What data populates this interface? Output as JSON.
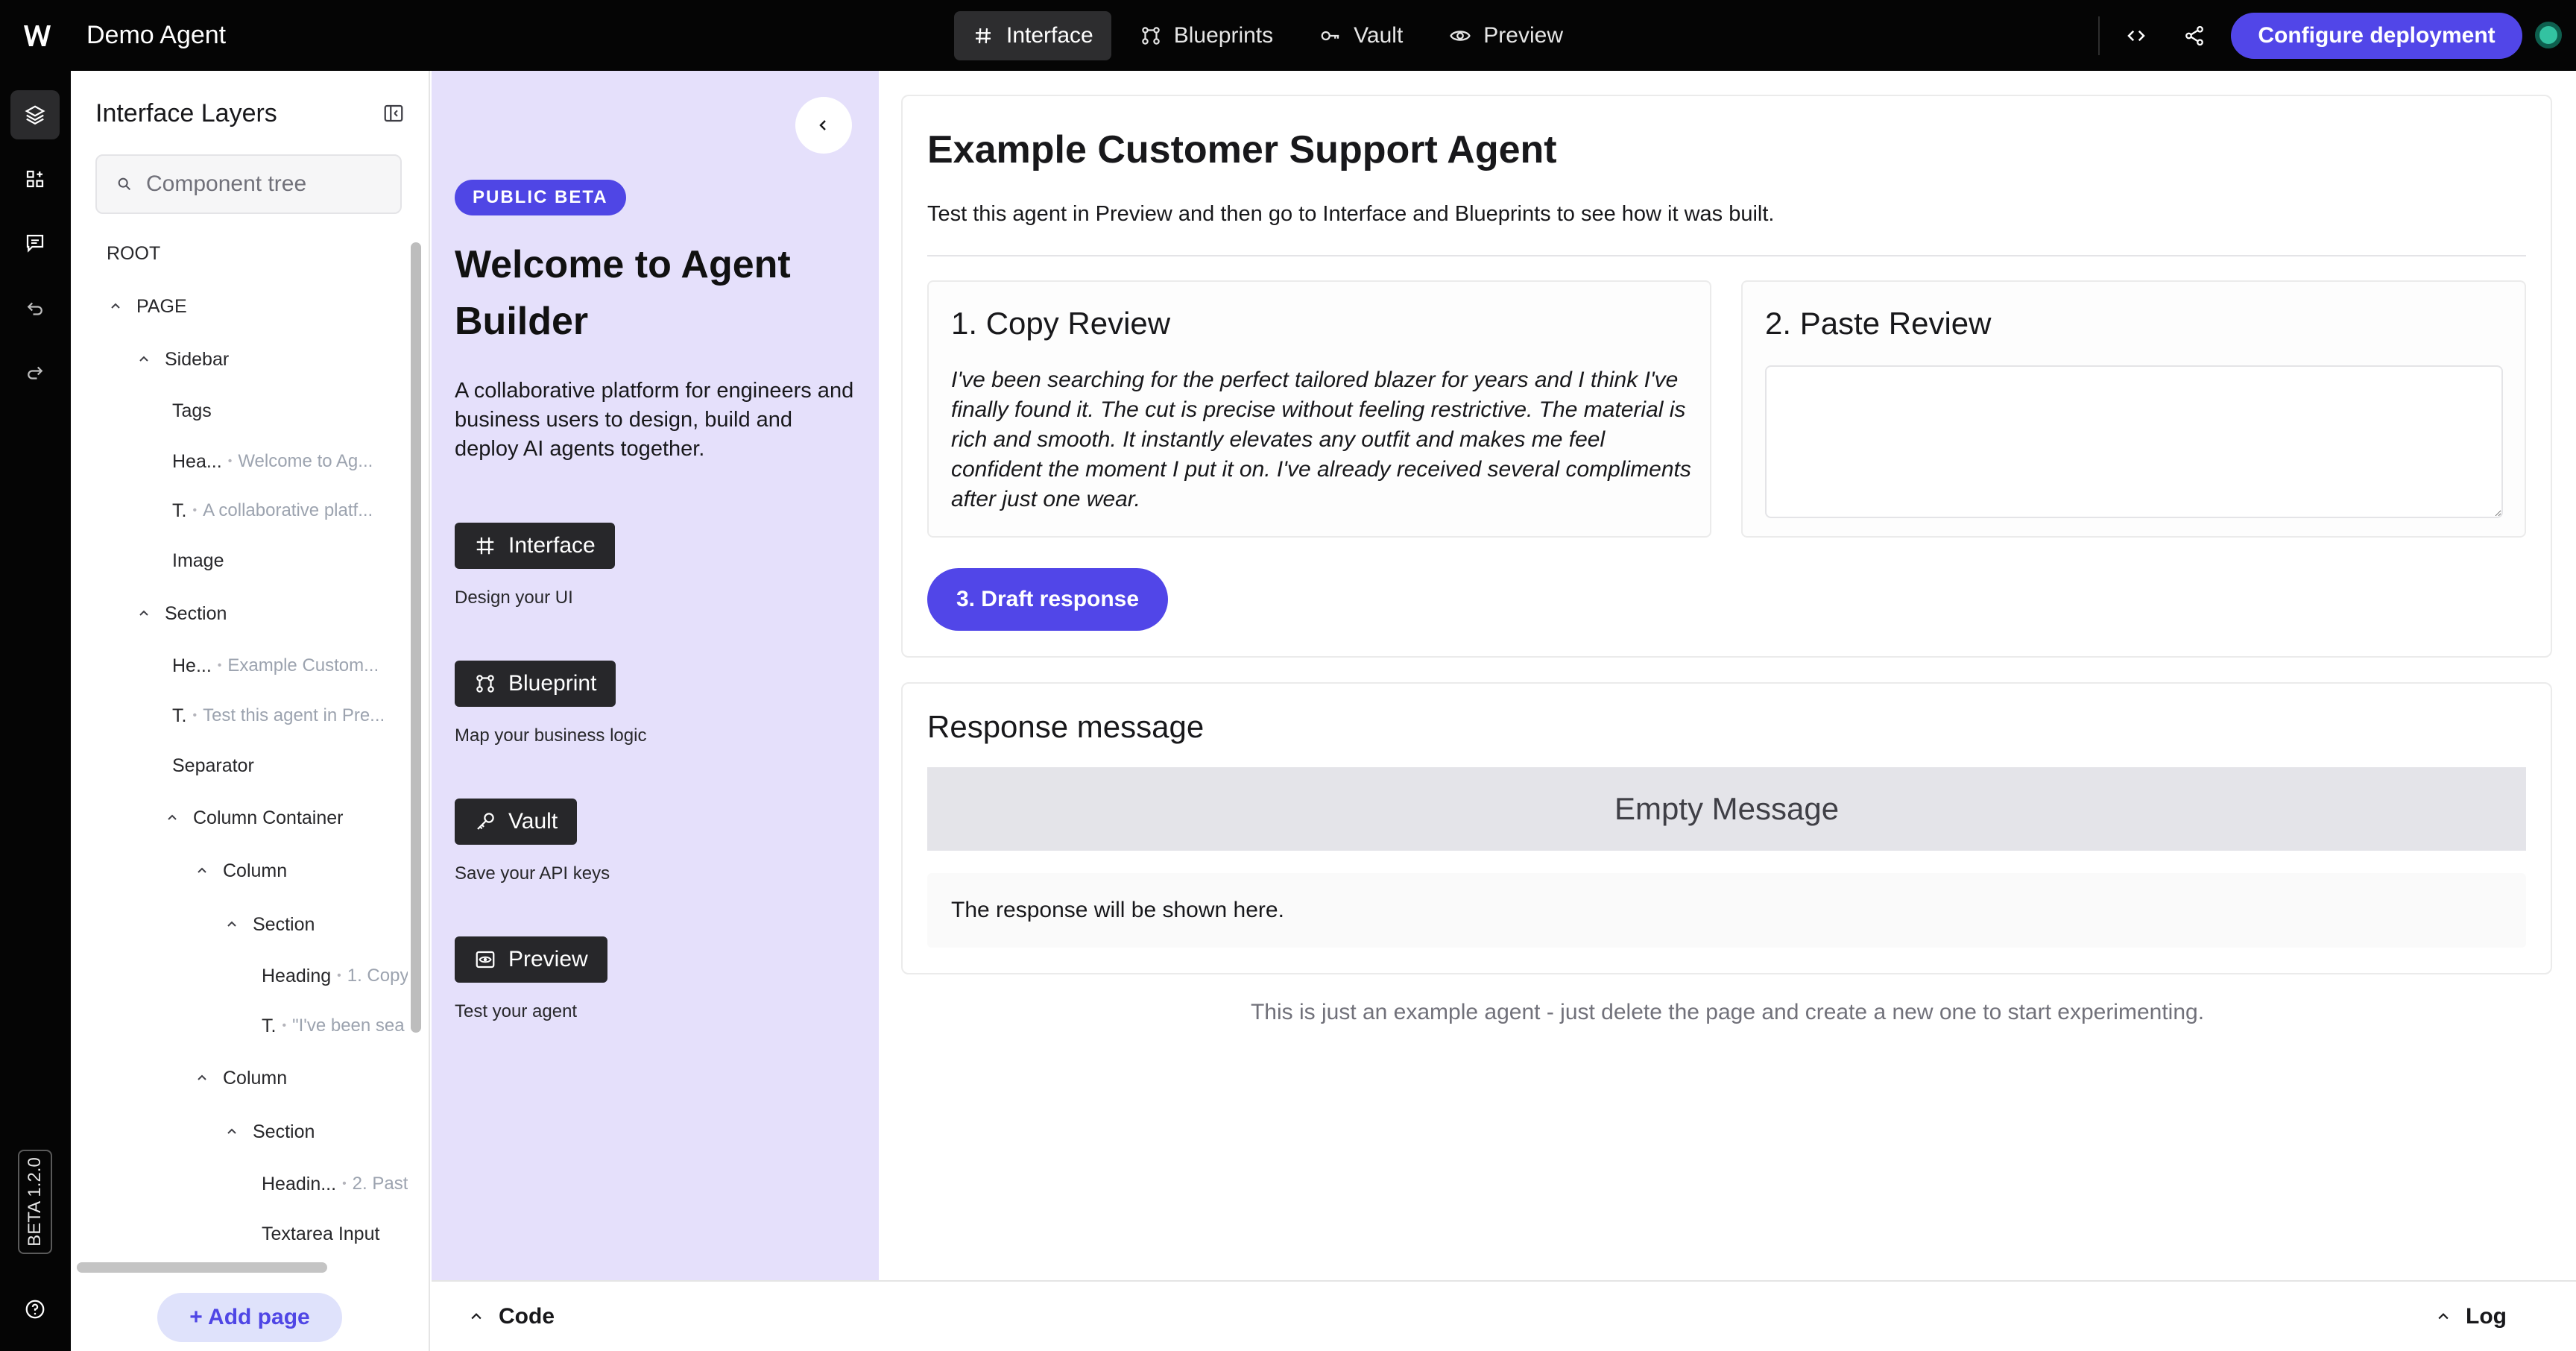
{
  "app": {
    "title": "Demo Agent"
  },
  "topnav": {
    "tabs": [
      {
        "label": "Interface",
        "icon": "hash-icon",
        "active": true
      },
      {
        "label": "Blueprints",
        "icon": "blueprint-icon"
      },
      {
        "label": "Vault",
        "icon": "key-icon"
      },
      {
        "label": "Preview",
        "icon": "eye-icon"
      }
    ],
    "deploy_label": "Configure deployment"
  },
  "rail": {
    "version": "BETA 1.2.0"
  },
  "layers": {
    "title": "Interface Layers",
    "search_placeholder": "Component tree",
    "tree": [
      {
        "label": "ROOT",
        "sub": ""
      },
      {
        "label": "PAGE",
        "sub": ""
      },
      {
        "label": "Sidebar",
        "sub": ""
      },
      {
        "label": "Tags",
        "sub": ""
      },
      {
        "label": "Hea...",
        "sub": "Welcome to Ag..."
      },
      {
        "label": "T.",
        "sub": "A collaborative platf..."
      },
      {
        "label": "Image",
        "sub": ""
      },
      {
        "label": "Section",
        "sub": ""
      },
      {
        "label": "He...",
        "sub": "Example Custom..."
      },
      {
        "label": "T.",
        "sub": "Test this agent in Pre..."
      },
      {
        "label": "Separator",
        "sub": ""
      },
      {
        "label": "Column Container",
        "sub": ""
      },
      {
        "label": "Column",
        "sub": ""
      },
      {
        "label": "Section",
        "sub": ""
      },
      {
        "label": "Heading",
        "sub": "1. Copy"
      },
      {
        "label": "T.",
        "sub": "\"I've been sea"
      },
      {
        "label": "Column",
        "sub": ""
      },
      {
        "label": "Section",
        "sub": ""
      },
      {
        "label": "Headin...",
        "sub": "2. Past"
      },
      {
        "label": "Textarea Input",
        "sub": ""
      }
    ],
    "add_page_label": "Add page"
  },
  "sidebar": {
    "badge": "PUBLIC BETA",
    "title": "Welcome to Agent Builder",
    "description": "A collaborative platform for engineers and business users to design, build and deploy AI agents together.",
    "features": [
      {
        "label": "Interface",
        "caption": "Design your UI",
        "icon": "hash-icon"
      },
      {
        "label": "Blueprint",
        "caption": "Map your business logic",
        "icon": "blueprint-icon"
      },
      {
        "label": "Vault",
        "caption": "Save your API keys",
        "icon": "key-icon"
      },
      {
        "label": "Preview",
        "caption": "Test your agent",
        "icon": "eye-icon"
      }
    ]
  },
  "main": {
    "title": "Example Customer Support Agent",
    "subtitle": "Test this agent in Preview and then go to Interface and Blueprints to see how it was built.",
    "copy_review": {
      "heading": "1. Copy Review",
      "text": "I've been searching for the perfect tailored blazer for years and I think I've finally found it. The cut is precise without feeling restrictive. The material is rich and smooth. It instantly elevates any outfit and makes me feel confident the moment I put it on. I've already received several compliments after just one wear."
    },
    "paste_review": {
      "heading": "2. Paste Review",
      "value": ""
    },
    "draft_label": "3. Draft response",
    "response": {
      "heading": "Response message",
      "empty": "Empty Message",
      "body": "The response will be shown here."
    },
    "footnote": "This is just an example agent - just delete the page and create a new one to start experimenting."
  },
  "bottombar": {
    "code_label": "Code",
    "log_label": "Log"
  },
  "colors": {
    "accent": "#5146e8",
    "sidebar_bg": "#e5e0fb",
    "topbar_bg": "#050505",
    "status": "#33c2a1"
  }
}
